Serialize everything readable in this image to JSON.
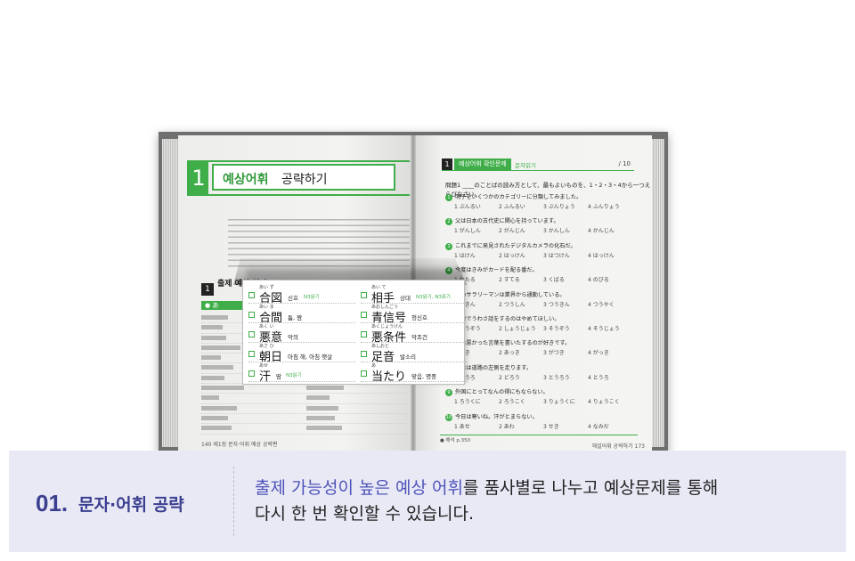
{
  "book": {
    "left_page": {
      "chapter_number": "1",
      "chapter_title_highlight": "예상어휘",
      "chapter_title_rest": "공략하기",
      "section_number": "1",
      "section_title": "출제 예상 명사",
      "green_label": "● あ",
      "footer": "140  제1장 문자·어휘 예상 공략편"
    },
    "right_page": {
      "header_number": "1",
      "header_tag": "예상어휘 확인문제",
      "header_tag2": "문자읽기",
      "score": "/ 10",
      "question": "問題1 ____のことばの読み方として、最もよいものを、1・2・3・4から一つえらびなさい。",
      "items": [
        {
          "n": "1",
          "text": "明子をいくつかのカテゴリーに分類してみました。",
          "choices": [
            "1 ぶんるい",
            "2 ふんるい",
            "3 ぶんりょう",
            "4 ふんりょう"
          ]
        },
        {
          "n": "2",
          "text": "父は日本の古代史に関心を持っています。",
          "choices": [
            "1 がんしん",
            "2 がんじん",
            "3 かんしん",
            "4 かんじん"
          ]
        },
        {
          "n": "3",
          "text": "これまでに発見されたデジタルカメラの化石だ。",
          "choices": [
            "1 はけん",
            "2 はっけん",
            "3 はつけん",
            "4 はっけん"
          ]
        },
        {
          "n": "4",
          "text": "今度はきみがカードを配る番だ。",
          "choices": [
            "1 わたる",
            "2 すてる",
            "3 くばる",
            "4 のびる"
          ]
        },
        {
          "n": "5",
          "text": "このサラリーマンは業界から通勤している。",
          "choices": [
            "1 つきん",
            "2 つうしん",
            "3 つうきん",
            "4 つうやく"
          ]
        },
        {
          "n": "6",
          "text": "電車でうわさ話をするのはやめてほしい。",
          "choices": [
            "1 そうぞう",
            "2 しょうじょう",
            "3 そうぞう",
            "4 そうじょう"
          ]
        },
        {
          "n": "7",
          "text": "私は悪かった言葉を書いたするのが好きです。",
          "choices": [
            "1 あき",
            "2 あっき",
            "3 がつき",
            "4 がっき"
          ]
        },
        {
          "n": "8",
          "text": "日本は道路の左側を走ります。",
          "choices": [
            "1 どうろ",
            "2 どろう",
            "3 とうろう",
            "4 とうろ"
          ]
        },
        {
          "n": "9",
          "text": "外国にとってなんの得にもならない。",
          "choices": [
            "1 ろうくに",
            "2 ろうこく",
            "3 りょうくに",
            "4 りょうこく"
          ]
        },
        {
          "n": "10",
          "text": "今日は寒いね。汗がとまらない。",
          "choices": [
            "1 あせ",
            "2 あわ",
            "3 せき",
            "4 なみだ"
          ]
        }
      ],
      "bottom": "● 해석 p.350",
      "page_number": "해설어휘 공략하기 173"
    },
    "zoom": {
      "left": [
        {
          "furi": "あい ず",
          "kanji": "合図",
          "mean": "신호",
          "level": "N3읽기"
        },
        {
          "furi": "あい ま",
          "kanji": "合間",
          "mean": "틈, 짬",
          "level": ""
        },
        {
          "furi": "あく い",
          "kanji": "悪意",
          "mean": "악의",
          "level": ""
        },
        {
          "furi": "あさ ひ",
          "kanji": "朝日",
          "mean": "아침 해, 아침 햇살",
          "level": ""
        },
        {
          "furi": "あせ",
          "kanji": "汗",
          "mean": "땀",
          "level": "N3읽기"
        }
      ],
      "right": [
        {
          "furi": "あい て",
          "kanji": "相手",
          "mean": "상대",
          "level": "N3읽기, N3표기"
        },
        {
          "furi": "あおしんごう",
          "kanji": "青信号",
          "mean": "청신호",
          "level": ""
        },
        {
          "furi": "あくじょうけん",
          "kanji": "悪条件",
          "mean": "악조건",
          "level": ""
        },
        {
          "furi": "あしおと",
          "kanji": "足音",
          "mean": "발소리",
          "level": ""
        },
        {
          "furi": "あ",
          "kanji": "当たり",
          "mean": "맞음, 명중",
          "level": ""
        }
      ]
    }
  },
  "info": {
    "number": "01.",
    "label": "문자·어휘 공략",
    "line1_highlight": "출제 가능성이 높은 예상 어휘",
    "line1_rest": "를 품사별로 나누고 예상문제를 통해",
    "line2": "다시 한 번 확인할 수 있습니다."
  }
}
